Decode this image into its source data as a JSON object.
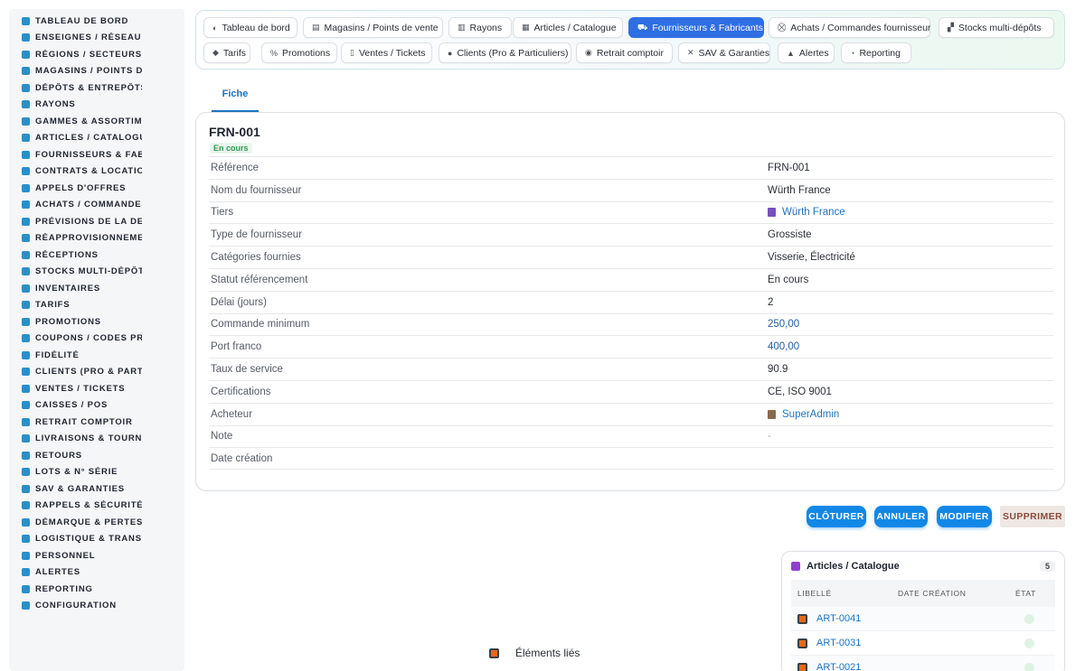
{
  "sidebar": {
    "items": [
      {
        "label": "TABLEAU DE BORD",
        "icon": "dashboard-icon"
      },
      {
        "label": "ENSEIGNES / RÉSEAU",
        "icon": "flag-icon"
      },
      {
        "label": "RÉGIONS / SECTEURS",
        "icon": "map-icon"
      },
      {
        "label": "MAGASINS / POINTS DE VENTE",
        "icon": "store-icon"
      },
      {
        "label": "DÉPÔTS & ENTREPÔTS",
        "icon": "warehouse-icon"
      },
      {
        "label": "RAYONS",
        "icon": "shelf-icon"
      },
      {
        "label": "GAMMES & ASSORTIMENTS",
        "icon": "list-icon"
      },
      {
        "label": "ARTICLES / CATALOGUE",
        "icon": "catalog-icon"
      },
      {
        "label": "FOURNISSEURS & FABRICANTS",
        "icon": "truck-icon"
      },
      {
        "label": "CONTRATS & LOCATION",
        "icon": "contract-icon"
      },
      {
        "label": "APPELS D'OFFRES",
        "icon": "gavel-icon"
      },
      {
        "label": "ACHATS / COMMANDES FOURNISSEUR",
        "icon": "cart-icon"
      },
      {
        "label": "PRÉVISIONS DE LA DEMANDE",
        "icon": "chart-icon"
      },
      {
        "label": "RÉAPPROVISIONNEMENT",
        "icon": "refresh-icon"
      },
      {
        "label": "RÉCEPTIONS",
        "icon": "inbox-icon"
      },
      {
        "label": "STOCKS MULTI-DÉPÔTS",
        "icon": "boxes-icon"
      },
      {
        "label": "INVENTAIRES",
        "icon": "clipboard-icon"
      },
      {
        "label": "TARIFS",
        "icon": "tag-icon"
      },
      {
        "label": "PROMOTIONS",
        "icon": "percent-icon"
      },
      {
        "label": "COUPONS / CODES PROMO",
        "icon": "percent-icon"
      },
      {
        "label": "FIDÉLITÉ",
        "icon": "card-icon"
      },
      {
        "label": "CLIENTS (PRO & PARTICULIERS)",
        "icon": "user-icon"
      },
      {
        "label": "VENTES / TICKETS",
        "icon": "receipt-icon"
      },
      {
        "label": "CAISSES / POS",
        "icon": "register-icon"
      },
      {
        "label": "RETRAIT COMPTOIR",
        "icon": "car-icon"
      },
      {
        "label": "LIVRAISONS & TOURNÉES",
        "icon": "delivery-icon"
      },
      {
        "label": "RETOURS",
        "icon": "undo-icon"
      },
      {
        "label": "LOTS & N° SÉRIE",
        "icon": "barcode-icon"
      },
      {
        "label": "SAV & GARANTIES",
        "icon": "tools-icon"
      },
      {
        "label": "RAPPELS & SÉCURITÉ",
        "icon": "warning-icon"
      },
      {
        "label": "DÉMARQUE & PERTES",
        "icon": "trash-icon"
      },
      {
        "label": "LOGISTIQUE & TRANSPORT",
        "icon": "truck-icon"
      },
      {
        "label": "PERSONNEL",
        "icon": "team-icon"
      },
      {
        "label": "ALERTES",
        "icon": "bell-icon"
      },
      {
        "label": "REPORTING",
        "icon": "pie-icon"
      },
      {
        "label": "CONFIGURATION",
        "icon": "gear-icon"
      }
    ]
  },
  "tabs": {
    "row1": [
      {
        "label": "Tableau de bord",
        "glyph": "◐",
        "active": false
      },
      {
        "label": "Magasins / Points de vente",
        "glyph": "▤",
        "active": false
      },
      {
        "label": "Rayons",
        "glyph": "▥",
        "active": false
      },
      {
        "label": "Articles / Catalogue",
        "glyph": "▦",
        "active": false
      },
      {
        "label": "Fournisseurs & Fabricants",
        "glyph": "⛟",
        "active": true
      },
      {
        "label": "Achats / Commandes fournisseur",
        "glyph": "⛒",
        "active": false
      },
      {
        "label": "Stocks multi-dépôts",
        "glyph": "▞",
        "active": false
      }
    ],
    "row2": [
      {
        "label": "Tarifs",
        "glyph": "◆",
        "active": false
      },
      {
        "label": "Promotions",
        "glyph": "%",
        "active": false
      },
      {
        "label": "Ventes / Tickets",
        "glyph": "▯",
        "active": false
      },
      {
        "label": "Clients (Pro & Particuliers)",
        "glyph": "●",
        "active": false
      },
      {
        "label": "Retrait comptoir",
        "glyph": "◉",
        "active": false
      },
      {
        "label": "SAV & Garanties",
        "glyph": "✕",
        "active": false
      },
      {
        "label": "Alertes",
        "glyph": "▲",
        "active": false
      },
      {
        "label": "Reporting",
        "glyph": "◔",
        "active": false
      }
    ]
  },
  "subtab": {
    "label": "Fiche"
  },
  "record": {
    "title": "FRN-001",
    "status_badge": "En cours",
    "fields": [
      {
        "label": "Référence",
        "value": "FRN-001",
        "kind": "text"
      },
      {
        "label": "Nom du fournisseur",
        "value": "Würth France",
        "kind": "text"
      },
      {
        "label": "Tiers",
        "value": "Würth France",
        "kind": "link",
        "icon": "building-icon"
      },
      {
        "label": "Type de fournisseur",
        "value": "Grossiste",
        "kind": "text"
      },
      {
        "label": "Catégories fournies",
        "value": "Visserie, Électricité",
        "kind": "text"
      },
      {
        "label": "Statut référencement",
        "value": "En cours",
        "kind": "text"
      },
      {
        "label": "Délai (jours)",
        "value": "2",
        "kind": "text"
      },
      {
        "label": "Commande minimum",
        "value": "250,00",
        "kind": "num"
      },
      {
        "label": "Port franco",
        "value": "400,00",
        "kind": "num"
      },
      {
        "label": "Taux de service",
        "value": "90.9",
        "kind": "text"
      },
      {
        "label": "Certifications",
        "value": "CE, ISO 9001",
        "kind": "text"
      },
      {
        "label": "Acheteur",
        "value": "SuperAdmin",
        "kind": "link",
        "icon": "user-icon"
      },
      {
        "label": "Note",
        "value": "-",
        "kind": "dash"
      },
      {
        "label": "Date création",
        "value": "",
        "kind": "text"
      }
    ]
  },
  "actions": {
    "close": "CLÔTURER",
    "cancel": "ANNULER",
    "edit": "MODIFIER",
    "delete": "SUPPRIMER"
  },
  "related": {
    "title": "Articles / Catalogue",
    "count": "5",
    "columns": [
      "Libellé",
      "Date création",
      "État"
    ],
    "rows": [
      {
        "label": "ART-0041"
      },
      {
        "label": "ART-0031"
      },
      {
        "label": "ART-0021"
      }
    ]
  },
  "linked": {
    "label": "Éléments liés"
  },
  "colors": {
    "accent": "#2f6fe4",
    "sidebar_icon": "#2a8fc9",
    "action_blue": "#1188e6",
    "status_green": "#2e9b4d"
  }
}
